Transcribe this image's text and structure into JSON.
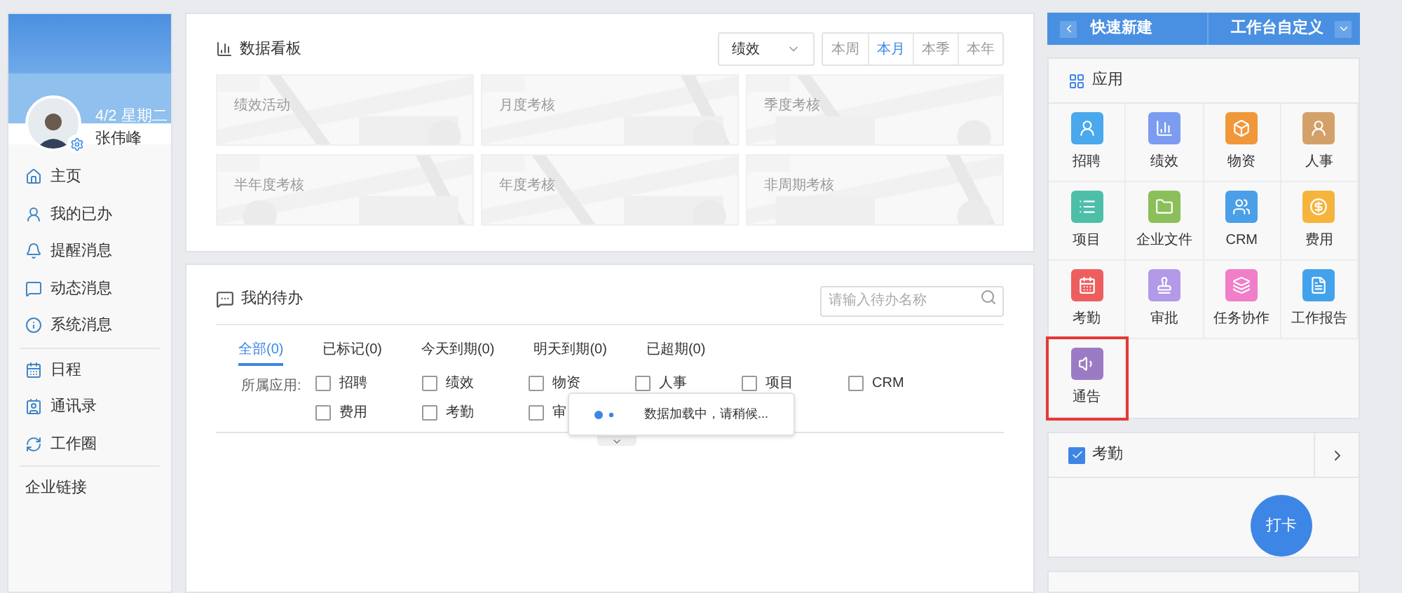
{
  "profile": {
    "date": "4/2 星期二",
    "name": "张伟峰"
  },
  "nav": [
    "主页",
    "我的已办",
    "提醒消息",
    "动态消息",
    "系统消息",
    "日程",
    "通讯录",
    "工作圈",
    "企业链接"
  ],
  "dashboard": {
    "title": "数据看板",
    "dropdown": "绩效",
    "periods": [
      {
        "label": "本周",
        "selected": false
      },
      {
        "label": "本月",
        "selected": true
      },
      {
        "label": "本季",
        "selected": false
      },
      {
        "label": "本年",
        "selected": false
      }
    ],
    "cards": [
      "绩效活动",
      "月度考核",
      "季度考核",
      "半年度考核",
      "年度考核",
      "非周期考核"
    ]
  },
  "todo": {
    "title": "我的待办",
    "search": {
      "placeholder": "请输入待办名称"
    },
    "tabs": [
      {
        "label": "全部(0)",
        "selected": true
      },
      {
        "label": "已标记(0)",
        "selected": false
      },
      {
        "label": "今天到期(0)",
        "selected": false
      },
      {
        "label": "明天到期(0)",
        "selected": false
      },
      {
        "label": "已超期(0)",
        "selected": false
      }
    ],
    "filter_label": "所属应用:",
    "filters": [
      {
        "label": "招聘",
        "checked": false
      },
      {
        "label": "绩效",
        "checked": false
      },
      {
        "label": "物资",
        "checked": false
      },
      {
        "label": "人事",
        "checked": false
      },
      {
        "label": "项目",
        "checked": false
      },
      {
        "label": "CRM",
        "checked": false
      },
      {
        "label": "费用",
        "checked": false
      },
      {
        "label": "考勤",
        "checked": false
      },
      {
        "label": "审",
        "checked": false
      }
    ],
    "loading": "数据加载中，请稍候..."
  },
  "quick": {
    "left": "快速新建",
    "right": "工作台自定义"
  },
  "apps": {
    "title": "应用",
    "items": [
      {
        "label": "招聘",
        "color": "#4aa8ec",
        "highlighted": false
      },
      {
        "label": "绩效",
        "color": "#7b9cf0",
        "highlighted": false
      },
      {
        "label": "物资",
        "color": "#f0973a",
        "highlighted": false
      },
      {
        "label": "人事",
        "color": "#d4a06a",
        "highlighted": false
      },
      {
        "label": "项目",
        "color": "#4dbfa8",
        "highlighted": false
      },
      {
        "label": "企业文件",
        "color": "#8bbf5a",
        "highlighted": false
      },
      {
        "label": "CRM",
        "color": "#4a9fe8",
        "highlighted": false
      },
      {
        "label": "费用",
        "color": "#f5b43c",
        "highlighted": false
      },
      {
        "label": "考勤",
        "color": "#ee5e5e",
        "highlighted": false
      },
      {
        "label": "审批",
        "color": "#b39ae8",
        "highlighted": false
      },
      {
        "label": "任务协作",
        "color": "#f07ec8",
        "highlighted": false
      },
      {
        "label": "工作报告",
        "color": "#43a2ec",
        "highlighted": false
      },
      {
        "label": "通告",
        "color": "#9b7cc4",
        "highlighted": true
      }
    ]
  },
  "attendance": {
    "title": "考勤",
    "checked": true,
    "button": "打卡"
  }
}
